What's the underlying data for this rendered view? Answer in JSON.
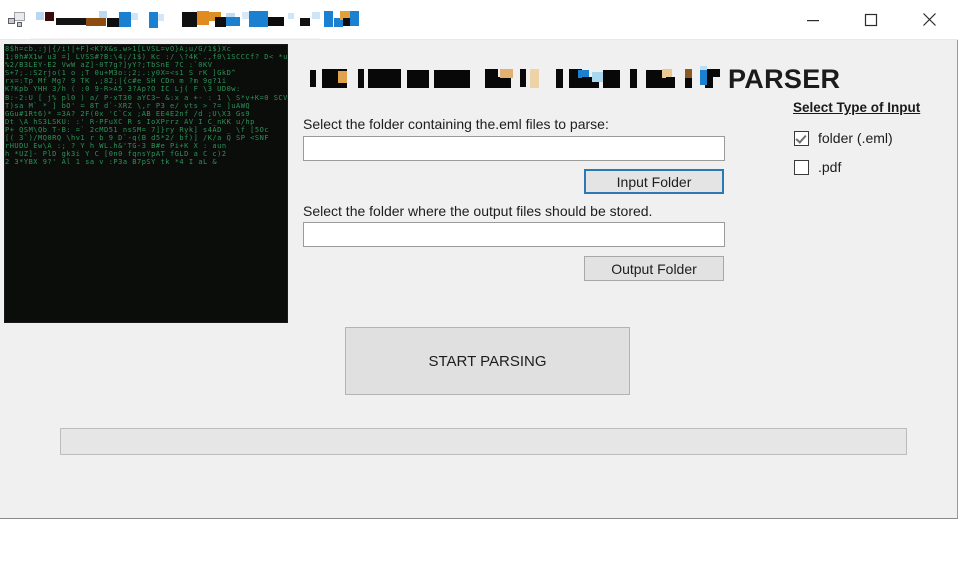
{
  "window": {
    "title_text": "",
    "title_redacted": true,
    "app_icon": "computer-network-icon",
    "controls": {
      "minimize": "─",
      "maximize": "□",
      "close": "✕"
    }
  },
  "header": {
    "redacted_prefix": "",
    "visible_text": "PARSER"
  },
  "input_type_panel": {
    "title": "Select Type of Input",
    "options": [
      {
        "label": "folder (.eml)",
        "checked": true
      },
      {
        "label": ".pdf",
        "checked": false
      }
    ]
  },
  "form": {
    "input_label": "Select the folder containing the.eml files to parse:",
    "input_value": "",
    "input_placeholder": "",
    "input_button": "Input Folder",
    "output_label": "Select the folder where the output files should be stored.",
    "output_value": "",
    "output_placeholder": "",
    "output_button": "Output Folder"
  },
  "actions": {
    "start_button": "START PARSING"
  },
  "progress": {
    "percent": 0,
    "text": ""
  },
  "decor": {
    "matrix_image": "matrix-code-rain",
    "matrix_chars": "8$h=cb.:j|{/i!|+F]<K?X&s.w>1[LVSL=vO}A;u/G/1$}Xc\n1;0h#X1w u3 =] LVSS#?B:\\4;/1$) Kc :/ \\?4K`.,f0\\1SCCCf? D< *u S*Yng\n%2/B3LEY-E2 VwW aZ]-0T7g?]yY?;TbSnE 7C :`0KV\nS+7;.:S2rjo(1 o ;T 0u+M3o:;2;.:y0X=<s1 S rK ]GkD^\nrx=:Tp Mf Mg? 9 TK ,;82;|{c#e SH CDn m ?m 9g?1i\nK?Kpb YHH 3/h ( :0 9-R>A5 3?Ap?O IC Lj( F \\3 UD0w:\nB:-2:U [ j% pl0 ) a/ P-xT30 aYC3~ &:x a +- : 1 \\ S*v+K=0 SCV\nT)sa M` * ] bO' = 8T d`-XRZ \\,r P3 e/ vts > ?= ]uAWQ\nGGu#1Rt6)* =3A? 2F(0x 'C`Cx ;AB EE4E2nf /d ;U\\X3 Gs9\nDt \\A hS3LSKU: :' R-PFuXC R s IoXPrrz AV I C_nKK u/hp\nP+ QSM\\Qb T-B: =` 2cMD51 nsSM= 7]}ry Ryk] s4AD _ \\f [5Oc\n[( 3`)/MQ0RQ \\hv1 r b 9 D`-q(B d5*2/ bf)] /K/a Q SP <SNF\nrHUDU Ew\\A :; ? Y h WL.h&'TG-3 B#e Pi+K X : aun\nh *UZ]- PlD gk3i Y C [0n0 fqnsYpAT fGLD a C c)2\n2 3*YBX 9?' Al 1 sa v :P3a B7pSY tk *4 I aL &"
  }
}
